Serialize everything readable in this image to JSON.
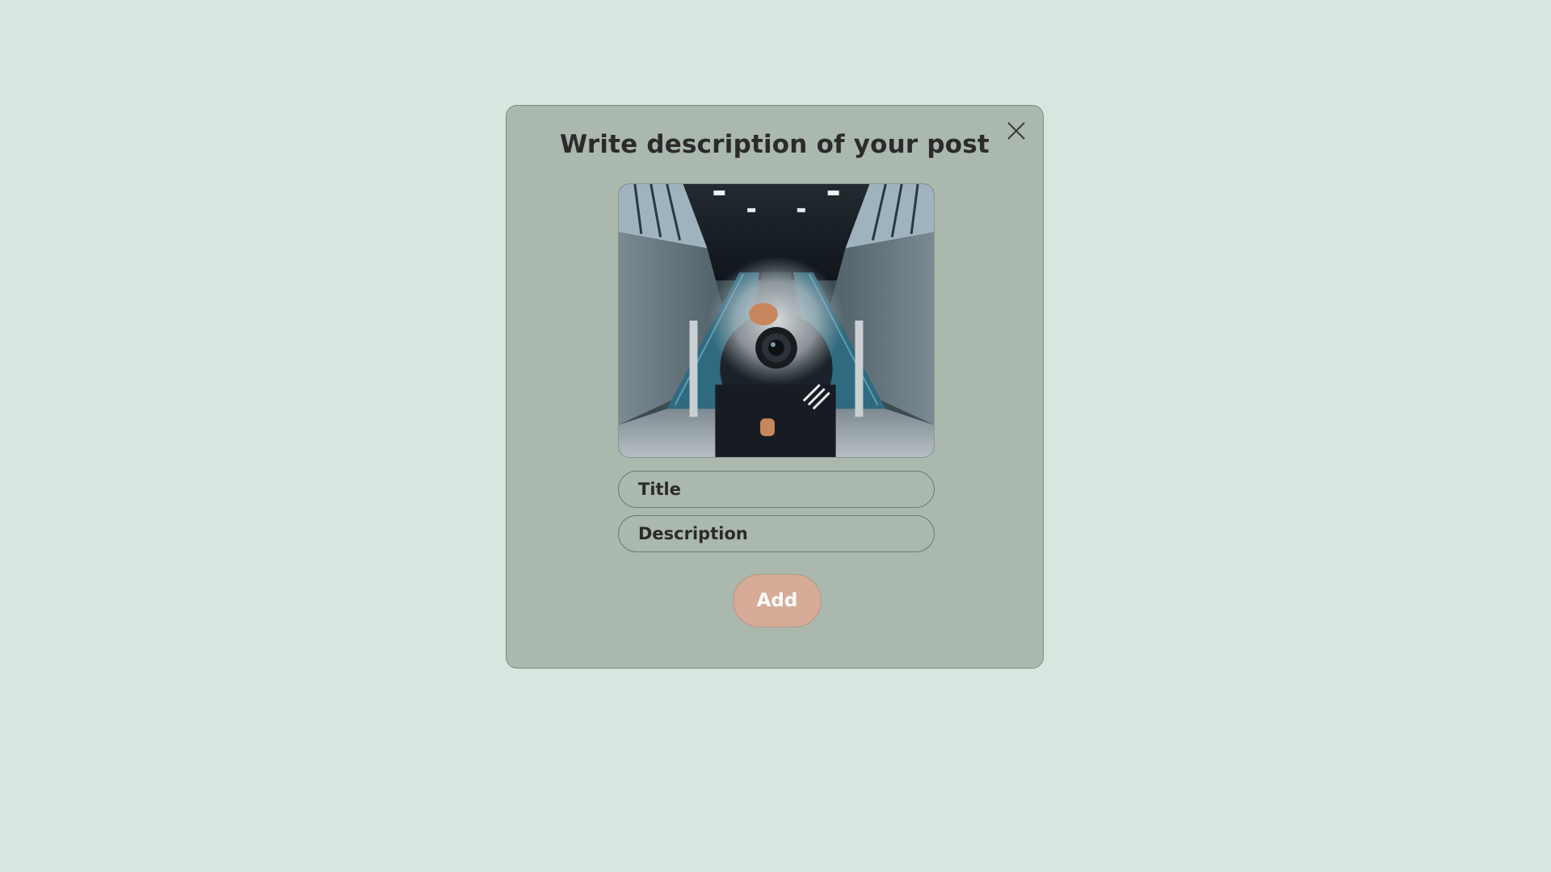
{
  "modal": {
    "title": "Write description of your post",
    "close_icon": "close-icon",
    "photo": {
      "subject": "post-photo",
      "description_icon": "photo-image"
    },
    "title_field": {
      "value": "",
      "placeholder": "Title"
    },
    "description_field": {
      "value": "",
      "placeholder": "Description"
    },
    "add_label": "Add"
  },
  "colors": {
    "page_background": "#d8e6df",
    "modal_background": "#abb8ae",
    "add_button": "#d6ab97",
    "text": "#2b2b2b"
  }
}
